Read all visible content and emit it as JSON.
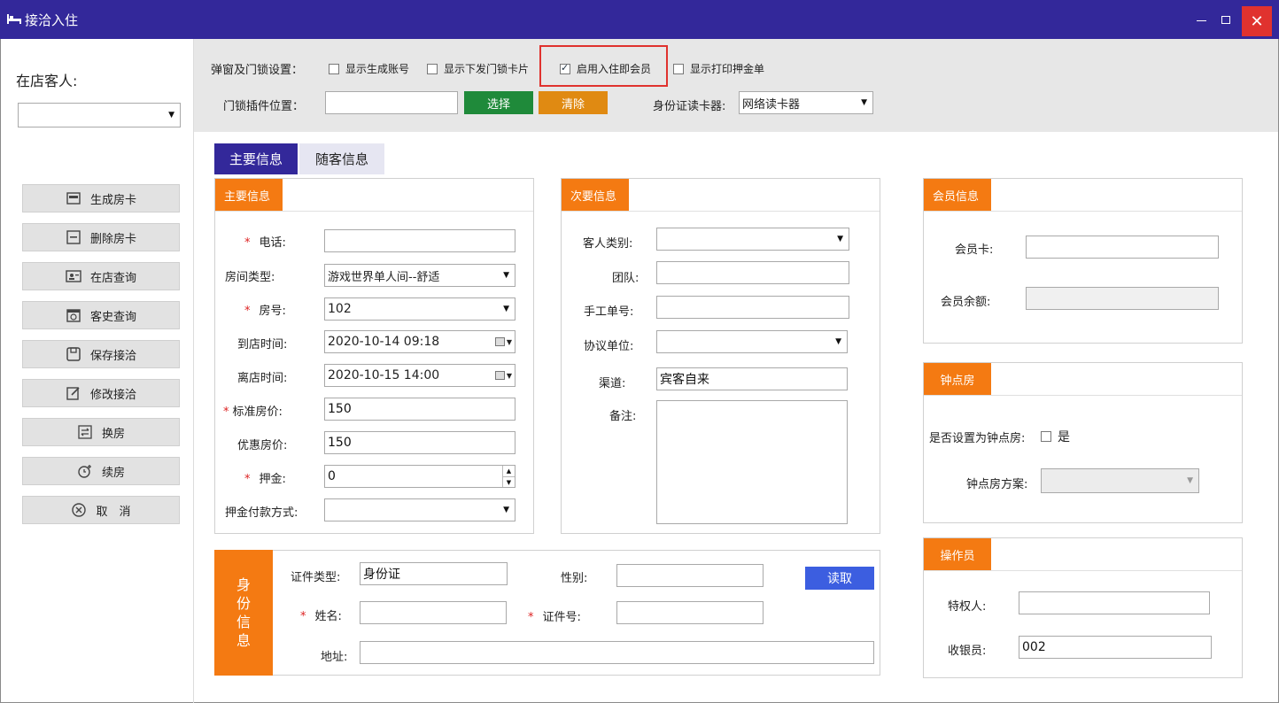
{
  "window": {
    "title": "接洽入住",
    "icons": {
      "app": "bed-icon",
      "minimize": "minimize-icon",
      "maximize": "maximize-icon",
      "close": "close-icon"
    }
  },
  "left": {
    "guests_label": "在店客人:",
    "guest_select_value": "",
    "buttons": [
      {
        "label": "生成房卡",
        "icon": "card-icon"
      },
      {
        "label": "删除房卡",
        "icon": "minus-box-icon"
      },
      {
        "label": "在店查询",
        "icon": "id-card-icon"
      },
      {
        "label": "客史查询",
        "icon": "calendar-icon"
      },
      {
        "label": "保存接洽",
        "icon": "save-icon"
      },
      {
        "label": "修改接洽",
        "icon": "edit-icon"
      },
      {
        "label": "换房",
        "icon": "swap-icon"
      },
      {
        "label": "续房",
        "icon": "clock-plus-icon"
      },
      {
        "label": "取　消",
        "icon": "cancel-circle-icon"
      }
    ]
  },
  "settings": {
    "popup_label": "弹窗及门锁设置：",
    "options": [
      {
        "label": "显示生成账号",
        "checked": false
      },
      {
        "label": "显示下发门锁卡片",
        "checked": false
      },
      {
        "label": "启用入住即会员",
        "checked": true
      },
      {
        "label": "显示打印押金单",
        "checked": false
      }
    ],
    "lock_plugin_label": "门锁插件位置：",
    "lock_plugin_value": "",
    "select_button": "选择",
    "clear_button": "清除",
    "id_reader_label": "身份证读卡器:",
    "id_reader_value": "网络读卡器",
    "colors": {
      "select": "#1f8a3a",
      "clear": "#e08a12",
      "highlight": "#e0322e"
    }
  },
  "tabs": [
    {
      "label": "主要信息",
      "active": true
    },
    {
      "label": "随客信息",
      "active": false
    }
  ],
  "main_info": {
    "header": "主要信息",
    "phone_label": "电话:",
    "phone_value": "",
    "room_type_label": "房间类型:",
    "room_type_value": "游戏世界单人间--舒适",
    "room_no_label": "房号:",
    "room_no_value": "102",
    "arrive_label": "到店时间:",
    "arrive_value": "2020-10-14 09:18",
    "leave_label": "离店时间:",
    "leave_value": "2020-10-15 14:00",
    "std_price_label": "标准房价:",
    "std_price_value": "150",
    "disc_price_label": "优惠房价:",
    "disc_price_value": "150",
    "deposit_label": "押金:",
    "deposit_value": "0",
    "pay_method_label": "押金付款方式:",
    "pay_method_value": ""
  },
  "secondary_info": {
    "header": "次要信息",
    "guest_type_label": "客人类别:",
    "guest_type_value": "",
    "team_label": "团队:",
    "team_value": "",
    "manual_no_label": "手工单号:",
    "manual_no_value": "",
    "agreement_label": "协议单位:",
    "agreement_value": "",
    "channel_label": "渠道:",
    "channel_value": "宾客自来",
    "remark_label": "备注:",
    "remark_value": ""
  },
  "member_info": {
    "header": "会员信息",
    "card_label": "会员卡:",
    "card_value": "",
    "balance_label": "会员余额:",
    "balance_value": ""
  },
  "hourly_room": {
    "header": "钟点房",
    "set_label": "是否设置为钟点房:",
    "yes_label": "是",
    "checked": false,
    "plan_label": "钟点房方案:",
    "plan_value": ""
  },
  "operator": {
    "header": "操作员",
    "privileged_label": "特权人:",
    "privileged_value": "",
    "cashier_label": "收银员:",
    "cashier_value": "002"
  },
  "id_info": {
    "side_label": "身\n份\n信\n息",
    "id_type_label": "证件类型:",
    "id_type_value": "身份证",
    "gender_label": "性别:",
    "gender_value": "",
    "read_button": "读取",
    "name_label": "姓名:",
    "name_value": "",
    "id_no_label": "证件号:",
    "id_no_value": "",
    "address_label": "地址:",
    "address_value": ""
  }
}
